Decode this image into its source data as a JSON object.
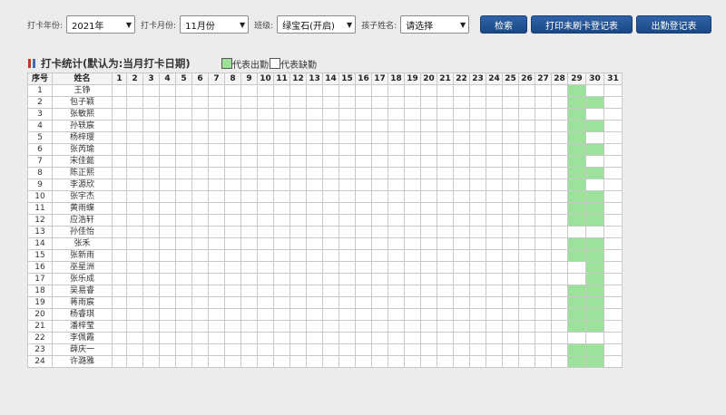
{
  "filters": {
    "year_label": "打卡年份:",
    "year_value": "2021年",
    "month_label": "打卡月份:",
    "month_value": "11月份",
    "class_label": "班级:",
    "class_value": "绿宝石(开启)",
    "child_label": "孩子姓名:",
    "child_value": "请选择"
  },
  "buttons": {
    "search": "检索",
    "print_unswiped": "打印未刷卡登记表",
    "attendance_register": "出勤登记表"
  },
  "section": {
    "title": "打卡统计(默认为:当月打卡日期)"
  },
  "legend": {
    "present_label": "代表出勤",
    "absent_label": "代表缺勤",
    "present_color": "#9de29a",
    "absent_color": "#ffffff"
  },
  "colors": {
    "accent": "#2459a0",
    "title_bar_red": "#c0392b",
    "title_bar_blue": "#3b6fb6"
  },
  "table": {
    "col_seq": "序号",
    "col_name": "姓名",
    "days": [
      "1",
      "2",
      "3",
      "4",
      "5",
      "6",
      "7",
      "8",
      "9",
      "10",
      "11",
      "12",
      "13",
      "14",
      "15",
      "16",
      "17",
      "18",
      "19",
      "20",
      "21",
      "22",
      "23",
      "24",
      "25",
      "26",
      "27",
      "28",
      "29",
      "30",
      "31"
    ],
    "rows": [
      {
        "seq": "1",
        "name": "王铮",
        "d29": 1,
        "d30": 0
      },
      {
        "seq": "2",
        "name": "包子颖",
        "d29": 1,
        "d30": 1
      },
      {
        "seq": "3",
        "name": "张敏熙",
        "d29": 1,
        "d30": 0
      },
      {
        "seq": "4",
        "name": "孙轶宸",
        "d29": 1,
        "d30": 1
      },
      {
        "seq": "5",
        "name": "杨梓璎",
        "d29": 1,
        "d30": 0
      },
      {
        "seq": "6",
        "name": "张芮瑜",
        "d29": 1,
        "d30": 1
      },
      {
        "seq": "7",
        "name": "宋佳懿",
        "d29": 1,
        "d30": 0
      },
      {
        "seq": "8",
        "name": "陈正熙",
        "d29": 1,
        "d30": 1
      },
      {
        "seq": "9",
        "name": "李源欣",
        "d29": 1,
        "d30": 0
      },
      {
        "seq": "10",
        "name": "张宇杰",
        "d29": 1,
        "d30": 1
      },
      {
        "seq": "11",
        "name": "黄雨蝶",
        "d29": 1,
        "d30": 1
      },
      {
        "seq": "12",
        "name": "应浩轩",
        "d29": 1,
        "d30": 1
      },
      {
        "seq": "13",
        "name": "孙佳怡",
        "d29": 0,
        "d30": 0
      },
      {
        "seq": "14",
        "name": "张禾",
        "d29": 1,
        "d30": 1
      },
      {
        "seq": "15",
        "name": "张新雨",
        "d29": 1,
        "d30": 1
      },
      {
        "seq": "16",
        "name": "巫星洲",
        "d29": 0,
        "d30": 1
      },
      {
        "seq": "17",
        "name": "张乐成",
        "d29": 0,
        "d30": 1
      },
      {
        "seq": "18",
        "name": "吴易睿",
        "d29": 1,
        "d30": 1
      },
      {
        "seq": "19",
        "name": "蒋雨宸",
        "d29": 1,
        "d30": 1
      },
      {
        "seq": "20",
        "name": "杨睿琪",
        "d29": 1,
        "d30": 1
      },
      {
        "seq": "21",
        "name": "潘梓莹",
        "d29": 1,
        "d30": 1
      },
      {
        "seq": "22",
        "name": "李佩霞",
        "d29": 0,
        "d30": 0
      },
      {
        "seq": "23",
        "name": "薛庆一",
        "d29": 1,
        "d30": 1
      },
      {
        "seq": "24",
        "name": "许潞雅",
        "d29": 1,
        "d30": 1
      }
    ]
  }
}
